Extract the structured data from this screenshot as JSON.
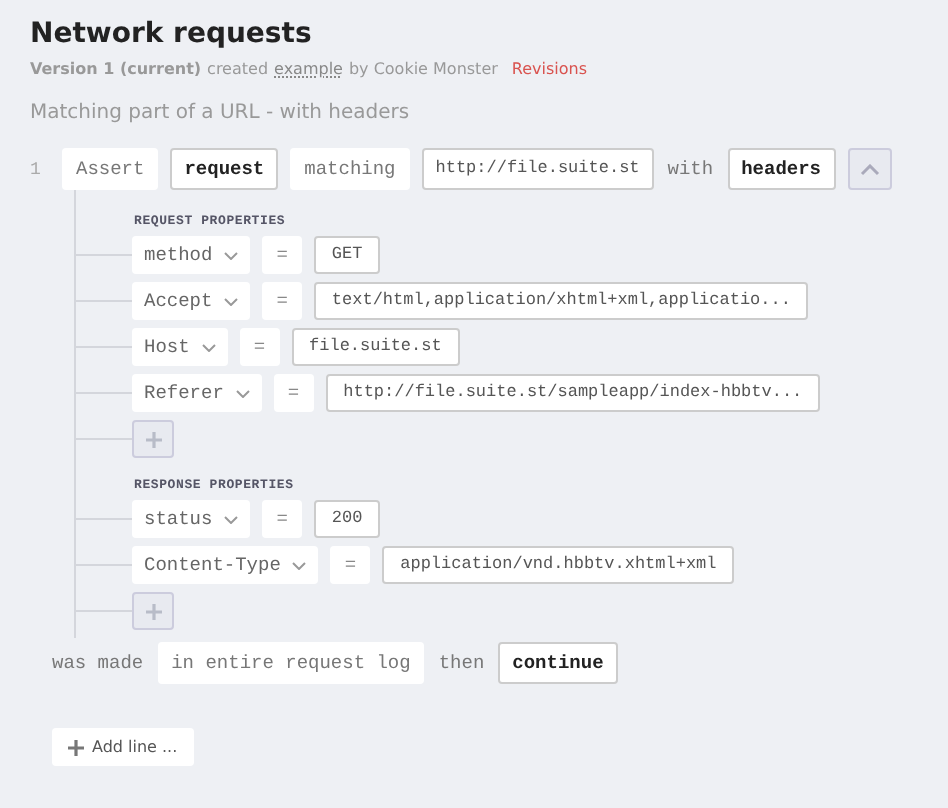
{
  "page": {
    "title": "Network requests",
    "meta": {
      "version": "Version 1 (current)",
      "created": "created",
      "example_link": "example",
      "by": "by Cookie Monster",
      "revisions_link": "Revisions"
    },
    "subtitle": "Matching part of a URL - with headers"
  },
  "step": {
    "number": "1",
    "tokens": [
      {
        "kind": "plain",
        "text": "Assert"
      },
      {
        "kind": "boxed",
        "text": "request"
      },
      {
        "kind": "plain",
        "text": "matching"
      },
      {
        "kind": "field",
        "text": "http://file.suite.st"
      },
      {
        "kind": "word",
        "text": "with"
      },
      {
        "kind": "boxed",
        "text": "headers"
      }
    ],
    "groups": [
      {
        "heading": "REQUEST PROPERTIES",
        "properties": [
          {
            "key": "method",
            "operator": "=",
            "value": "GET"
          },
          {
            "key": "Accept",
            "operator": "=",
            "value": "text/html,application/xhtml+xml,applicatio..."
          },
          {
            "key": "Host",
            "operator": "=",
            "value": "file.suite.st"
          },
          {
            "key": "Referer",
            "operator": "=",
            "value": "http://file.suite.st/sampleapp/index-hbbtv..."
          }
        ]
      },
      {
        "heading": "RESPONSE PROPERTIES",
        "properties": [
          {
            "key": "status",
            "operator": "=",
            "value": "200"
          },
          {
            "key": "Content-Type",
            "operator": "=",
            "value": "application/vnd.hbbtv.xhtml+xml"
          }
        ]
      }
    ],
    "tail": [
      {
        "kind": "word",
        "text": "was made"
      },
      {
        "kind": "plain",
        "text": "in entire request log"
      },
      {
        "kind": "word",
        "text": "then"
      },
      {
        "kind": "boxed",
        "text": "continue"
      }
    ]
  },
  "add_line": "Add line ..."
}
